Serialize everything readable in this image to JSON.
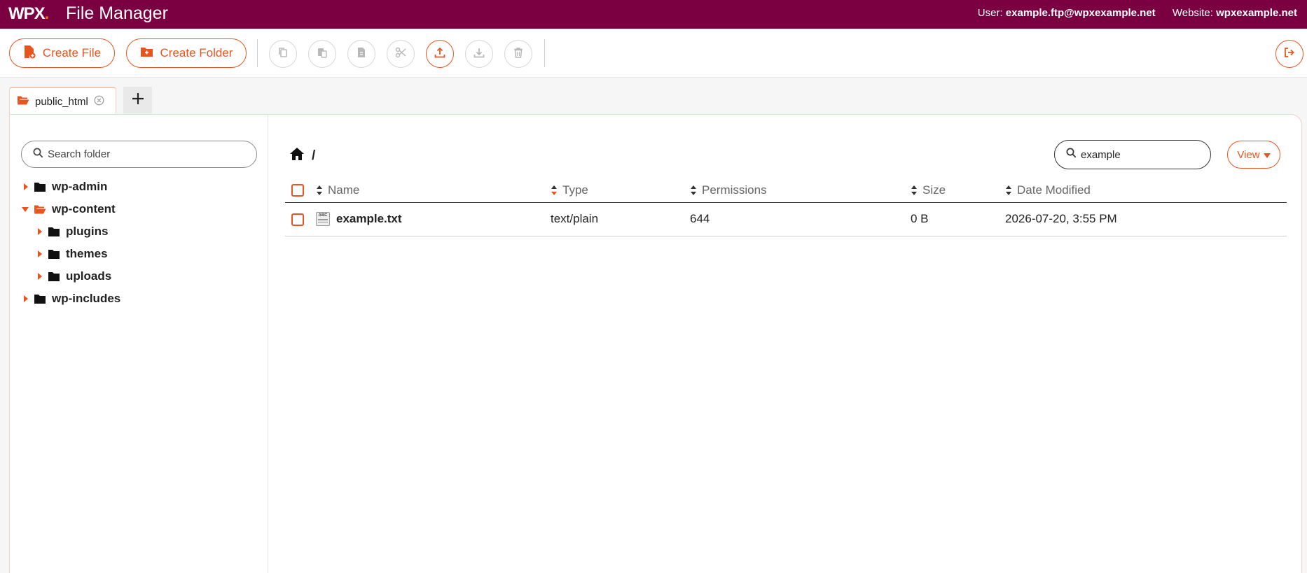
{
  "header": {
    "logo": "WPX",
    "logo_dot": ".",
    "title": "File Manager",
    "user_label": "User:",
    "user": "example.ftp@wpxexample.net",
    "website_label": "Website:",
    "website": "wpxexample.net"
  },
  "toolbar": {
    "create_file": "Create File",
    "create_folder": "Create Folder",
    "icons": [
      "copy-icon",
      "paste-icon",
      "duplicate-icon",
      "cut-icon",
      "upload-icon",
      "download-icon",
      "delete-icon",
      "logout-icon"
    ]
  },
  "tabs": [
    {
      "label": "public_html"
    }
  ],
  "sidebar": {
    "search_placeholder": "Search folder",
    "tree": [
      {
        "name": "wp-admin",
        "expanded": false,
        "level": 0
      },
      {
        "name": "wp-content",
        "expanded": true,
        "level": 0
      },
      {
        "name": "plugins",
        "expanded": false,
        "level": 1
      },
      {
        "name": "themes",
        "expanded": false,
        "level": 1
      },
      {
        "name": "uploads",
        "expanded": false,
        "level": 1
      },
      {
        "name": "wp-includes",
        "expanded": false,
        "level": 0
      }
    ]
  },
  "content": {
    "breadcrumb_sep": "/",
    "search_value": "example",
    "view_label": "View",
    "columns": [
      "Name",
      "Type",
      "Permissions",
      "Size",
      "Date Modified"
    ],
    "rows": [
      {
        "name": "example.txt",
        "type": "text/plain",
        "permissions": "644",
        "size": "0 B",
        "modified": "2026-07-20, 3:55 PM"
      }
    ]
  },
  "colors": {
    "brand": "#7a0041",
    "accent": "#e8541d"
  }
}
